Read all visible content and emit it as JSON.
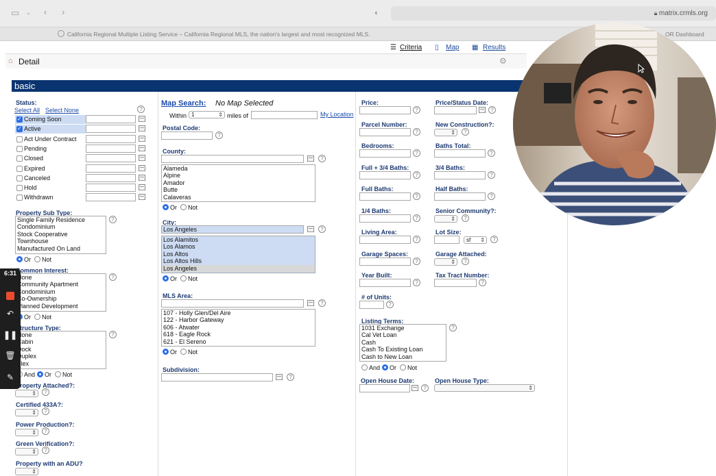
{
  "browser": {
    "url": "matrix.crmls.org",
    "tab_title": "California Regional Multiple Listing Service – California Regional MLS, the nation's largest and most recognized MLS.",
    "tab_right": "OR Dashboard"
  },
  "views": {
    "criteria": "Criteria",
    "map": "Map",
    "results": "Results"
  },
  "page": {
    "title": "Detail",
    "section": "basic"
  },
  "status": {
    "label": "Status:",
    "select_all": "Select All",
    "select_none": "Select None",
    "items": [
      {
        "label": "Coming Soon",
        "checked": true
      },
      {
        "label": "Active",
        "checked": true
      },
      {
        "label": "Act Under Contract",
        "checked": false
      },
      {
        "label": "Pending",
        "checked": false
      },
      {
        "label": "Closed",
        "checked": false
      },
      {
        "label": "Expired",
        "checked": false
      },
      {
        "label": "Canceled",
        "checked": false
      },
      {
        "label": "Hold",
        "checked": false
      },
      {
        "label": "Withdrawn",
        "checked": false
      }
    ]
  },
  "property_sub_type": {
    "label": "Property Sub Type:",
    "options": [
      "Single Family Residence",
      "Condominium",
      "Stock Cooperative",
      "Townhouse",
      "Manufactured On Land"
    ]
  },
  "common_interest": {
    "label": "Common Interest:",
    "options": [
      "None",
      "Community Apartment",
      "Condominium",
      "Co-Ownership",
      "Planned Development"
    ]
  },
  "structure_type": {
    "label": "Structure Type:",
    "options": [
      "None",
      "Cabin",
      "Dock",
      "Duplex",
      "Flex"
    ]
  },
  "radio_labels": {
    "and": "And",
    "or": "Or",
    "not": "Not"
  },
  "left_selects": [
    {
      "label": "Property Attached?:"
    },
    {
      "label": "Certified 433A?:"
    },
    {
      "label": "Power Production?:"
    },
    {
      "label": "Green Verification?:"
    },
    {
      "label": "Property with an ADU?"
    }
  ],
  "map_search": {
    "label": "Map Search:",
    "value": "No Map Selected",
    "within_label": "Within",
    "within_value": "1",
    "miles_of": "miles of",
    "my_location": "My Location"
  },
  "postal_code": {
    "label": "Postal Code:"
  },
  "county": {
    "label": "County:",
    "options": [
      "Alameda",
      "Alpine",
      "Amador",
      "Butte",
      "Calaveras"
    ]
  },
  "city": {
    "label": "City:",
    "value": "Los Angeles",
    "options": [
      "Los Alamitos",
      "Los Alamos",
      "Los Altos",
      "Los Altos Hills",
      "Los Angeles"
    ]
  },
  "mls_area": {
    "label": "MLS Area:",
    "options": [
      "107 - Holly Glen/Del Aire",
      "122 - Harbor Gateway",
      "606 - Atwater",
      "618 - Eagle Rock",
      "621 - El Sereno"
    ]
  },
  "subdivision": {
    "label": "Subdivision:"
  },
  "right_fields": {
    "price": "Price:",
    "price_status_date": "Price/Status Date:",
    "parcel_number": "Parcel Number:",
    "new_construction": "New Construction?:",
    "bedrooms": "Bedrooms:",
    "baths_total": "Baths Total:",
    "full_34_baths": "Full + 3/4 Baths:",
    "baths_34": "3/4 Baths:",
    "full_baths": "Full Baths:",
    "half_baths": "Half Baths:",
    "baths_14": "1/4 Baths:",
    "senior_community": "Senior Community?:",
    "living_area": "Living Area:",
    "lot_size": "Lot Size:",
    "lot_unit": "sf",
    "garage_spaces": "Garage Spaces:",
    "garage_attached": "Garage Attached:",
    "year_built": "Year Built:",
    "tax_tract": "Tax Tract Number:",
    "units": "# of Units:"
  },
  "listing_terms": {
    "label": "Listing Terms:",
    "options": [
      "1031 Exchange",
      "Cal Vet Loan",
      "Cash",
      "Cash To Existing Loan",
      "Cash to New Loan"
    ]
  },
  "open_house": {
    "date": "Open House Date:",
    "type": "Open House Type:"
  },
  "recorder": {
    "time": "6:31"
  },
  "icons": [
    "sidebar-icon",
    "back-icon",
    "forward-icon",
    "shield-icon",
    "lock-icon",
    "home-icon",
    "gear-icon",
    "help-icon",
    "calendar-icon"
  ]
}
